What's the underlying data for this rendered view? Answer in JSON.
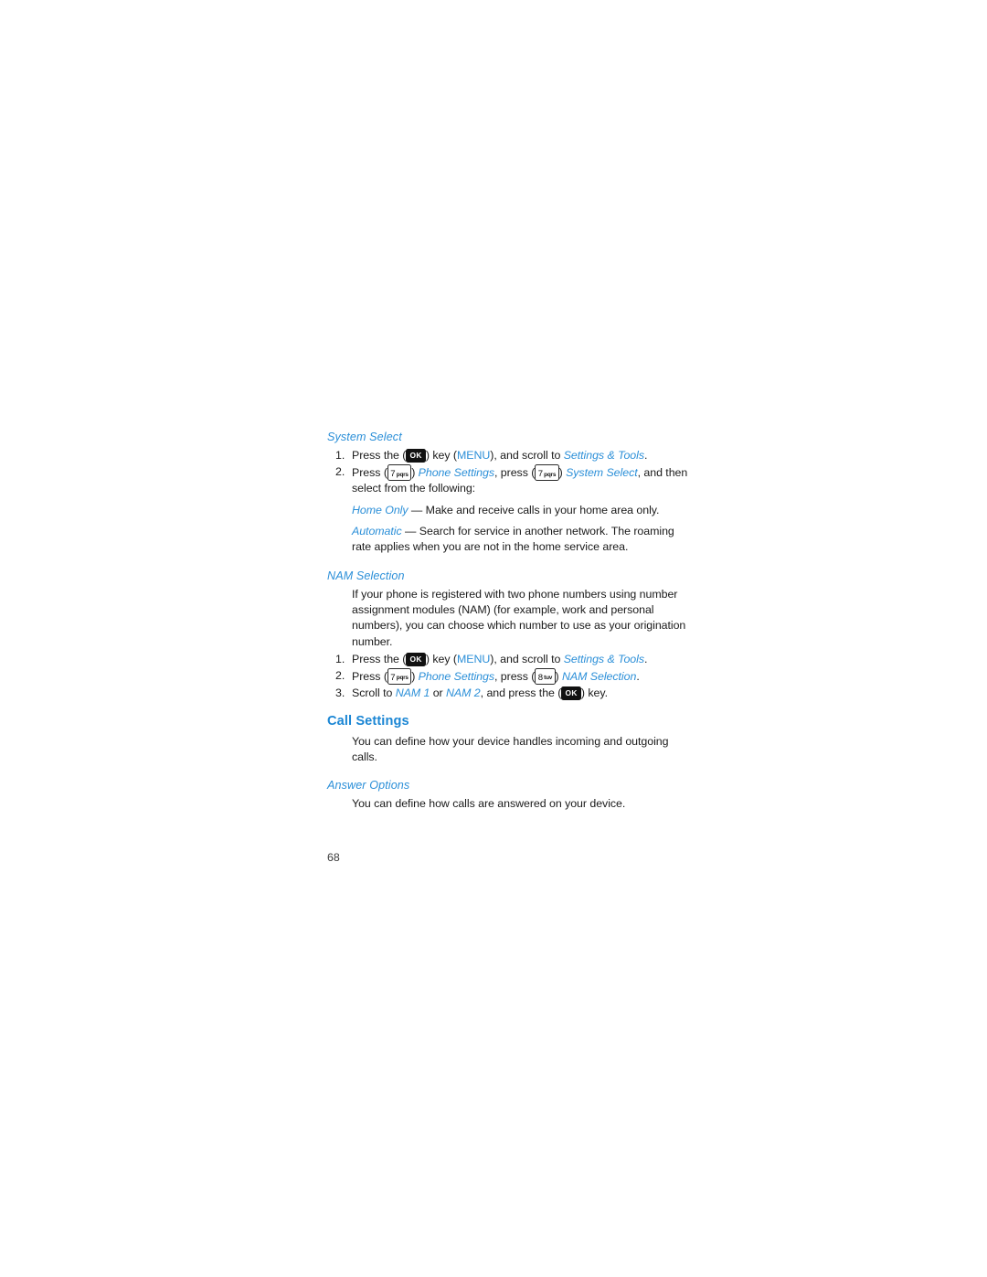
{
  "document": {
    "page_number": "68",
    "colors": {
      "heading_blue": "#1b86d4",
      "subheading_blue": "#2b8fd8",
      "body_text": "#1a1a1a",
      "key_dark": "#111111",
      "background": "#ffffff"
    }
  },
  "sections": [
    {
      "id": "system_select",
      "subheading": "System Select",
      "steps": [
        {
          "number": "1.",
          "parts": [
            {
              "type": "text",
              "value": "Press the ("
            },
            {
              "type": "key_ok",
              "value": "OK"
            },
            {
              "type": "text",
              "value": ") key ("
            },
            {
              "type": "blue_upright",
              "value": "MENU"
            },
            {
              "type": "text",
              "value": "), and scroll to "
            },
            {
              "type": "blue_italic",
              "value": "Settings & Tools"
            },
            {
              "type": "text",
              "value": "."
            }
          ]
        },
        {
          "number": "2.",
          "parts": [
            {
              "type": "text",
              "value": "Press ("
            },
            {
              "type": "key_num",
              "digit": "7",
              "letters": "pqrs"
            },
            {
              "type": "text",
              "value": ") "
            },
            {
              "type": "blue_italic",
              "value": "Phone Settings"
            },
            {
              "type": "text",
              "value": ", press ("
            },
            {
              "type": "key_num",
              "digit": "7",
              "letters": "pqrs"
            },
            {
              "type": "text",
              "value": ") "
            },
            {
              "type": "blue_italic",
              "value": "System Select"
            },
            {
              "type": "text",
              "value": ", and then select from the following:"
            }
          ]
        }
      ],
      "definitions": [
        {
          "term": "Home Only",
          "dash": " — ",
          "description": "Make and receive calls in your home area only."
        },
        {
          "term": "Automatic",
          "dash": " — ",
          "description": "Search for service in another network. The roaming rate applies when you are not in the home service area."
        }
      ]
    },
    {
      "id": "nam_selection",
      "subheading": "NAM Selection",
      "paragraph": "If your phone is registered with two phone numbers using number assignment modules (NAM) (for example, work and personal numbers), you can choose which number to use as your origination number.",
      "steps": [
        {
          "number": "1.",
          "parts": [
            {
              "type": "text",
              "value": "Press the ("
            },
            {
              "type": "key_ok",
              "value": "OK"
            },
            {
              "type": "text",
              "value": ") key ("
            },
            {
              "type": "blue_upright",
              "value": "MENU"
            },
            {
              "type": "text",
              "value": "), and scroll to "
            },
            {
              "type": "blue_italic",
              "value": "Settings & Tools"
            },
            {
              "type": "text",
              "value": "."
            }
          ]
        },
        {
          "number": "2.",
          "parts": [
            {
              "type": "text",
              "value": "Press ("
            },
            {
              "type": "key_num",
              "digit": "7",
              "letters": "pqrs"
            },
            {
              "type": "text",
              "value": ") "
            },
            {
              "type": "blue_italic",
              "value": "Phone Settings"
            },
            {
              "type": "text",
              "value": ", press ("
            },
            {
              "type": "key_num",
              "digit": "8",
              "letters": "tuv"
            },
            {
              "type": "text",
              "value": ") "
            },
            {
              "type": "blue_italic",
              "value": "NAM Selection"
            },
            {
              "type": "text",
              "value": "."
            }
          ]
        },
        {
          "number": "3.",
          "parts": [
            {
              "type": "text",
              "value": "Scroll to "
            },
            {
              "type": "blue_italic",
              "value": "NAM 1"
            },
            {
              "type": "text",
              "value": " or "
            },
            {
              "type": "blue_italic",
              "value": "NAM 2"
            },
            {
              "type": "text",
              "value": ", and press the ("
            },
            {
              "type": "key_ok",
              "value": "OK"
            },
            {
              "type": "text",
              "value": ") key."
            }
          ]
        }
      ]
    },
    {
      "id": "call_settings",
      "heading": "Call Settings",
      "paragraph": "You can define how your device handles incoming and outgoing calls."
    },
    {
      "id": "answer_options",
      "subheading": "Answer Options",
      "paragraph": "You can define how calls are answered on your device."
    }
  ]
}
